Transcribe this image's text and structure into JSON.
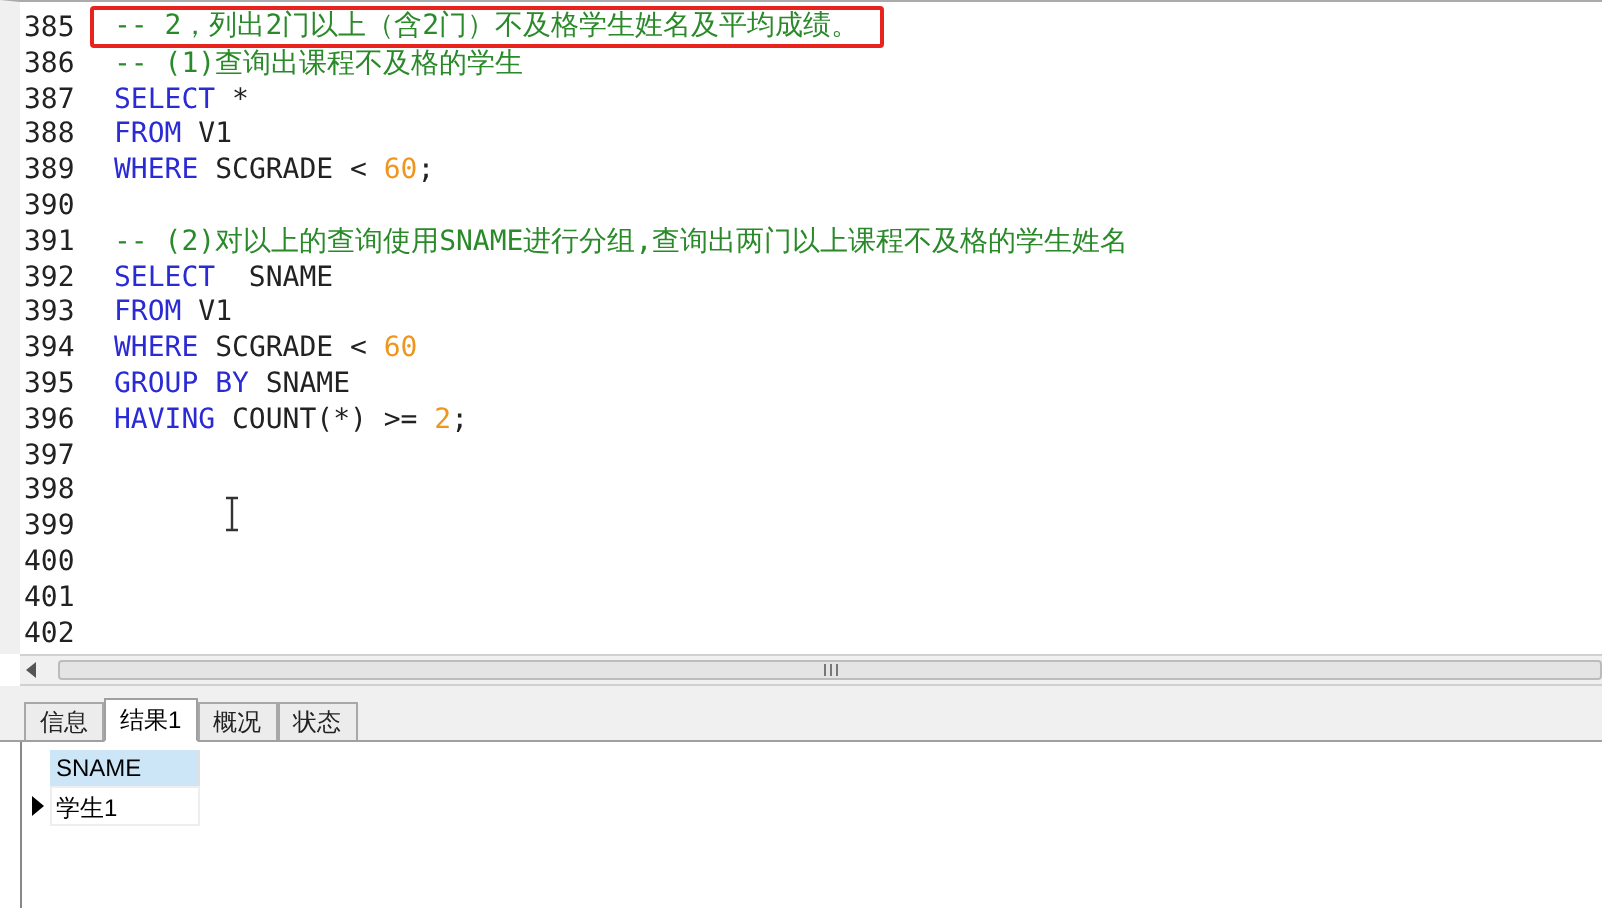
{
  "editor": {
    "lines": [
      {
        "number": "385",
        "highlighted": true,
        "tokens": [
          {
            "kind": "comment",
            "text": "-- 2，列出2门以上（含2门）不及格学生姓名及平均成绩。"
          }
        ]
      },
      {
        "number": "386",
        "highlighted": false,
        "tokens": [
          {
            "kind": "comment",
            "text": "-- (1)查询出课程不及格的学生"
          }
        ]
      },
      {
        "number": "387",
        "highlighted": false,
        "tokens": [
          {
            "kind": "keyword",
            "text": "SELECT"
          },
          {
            "kind": "plain",
            "text": " *"
          }
        ]
      },
      {
        "number": "388",
        "highlighted": false,
        "tokens": [
          {
            "kind": "keyword",
            "text": "FROM"
          },
          {
            "kind": "plain",
            "text": " V1"
          }
        ]
      },
      {
        "number": "389",
        "highlighted": false,
        "tokens": [
          {
            "kind": "keyword",
            "text": "WHERE"
          },
          {
            "kind": "plain",
            "text": " SCGRADE < "
          },
          {
            "kind": "number",
            "text": "60"
          },
          {
            "kind": "plain",
            "text": ";"
          }
        ]
      },
      {
        "number": "390",
        "highlighted": false
      },
      {
        "number": "391",
        "highlighted": false,
        "tokens": [
          {
            "kind": "comment",
            "text": "-- (2)对以上的查询使用SNAME进行分组,查询出两门以上课程不及格的学生姓名"
          }
        ]
      },
      {
        "number": "392",
        "highlighted": false,
        "tokens": [
          {
            "kind": "keyword",
            "text": "SELECT"
          },
          {
            "kind": "plain",
            "text": "  SNAME"
          }
        ]
      },
      {
        "number": "393",
        "highlighted": false,
        "tokens": [
          {
            "kind": "keyword",
            "text": "FROM"
          },
          {
            "kind": "plain",
            "text": " V1"
          }
        ]
      },
      {
        "number": "394",
        "highlighted": false,
        "tokens": [
          {
            "kind": "keyword",
            "text": "WHERE"
          },
          {
            "kind": "plain",
            "text": " SCGRADE < "
          },
          {
            "kind": "number",
            "text": "60"
          }
        ]
      },
      {
        "number": "395",
        "highlighted": false,
        "tokens": [
          {
            "kind": "keyword",
            "text": "GROUP BY"
          },
          {
            "kind": "plain",
            "text": " SNAME"
          }
        ]
      },
      {
        "number": "396",
        "highlighted": false,
        "tokens": [
          {
            "kind": "keyword",
            "text": "HAVING"
          },
          {
            "kind": "plain",
            "text": " COUNT(*) >= "
          },
          {
            "kind": "number",
            "text": "2"
          },
          {
            "kind": "plain",
            "text": ";"
          }
        ]
      },
      {
        "number": "397",
        "highlighted": false
      },
      {
        "number": "398",
        "highlighted": false
      },
      {
        "number": "399",
        "highlighted": false
      },
      {
        "number": "400",
        "highlighted": false
      },
      {
        "number": "401",
        "highlighted": false
      },
      {
        "number": "402",
        "highlighted": false
      }
    ]
  },
  "tabs": [
    {
      "label": "信息",
      "selected": false
    },
    {
      "label": "结果1",
      "selected": true
    },
    {
      "label": "概况",
      "selected": false
    },
    {
      "label": "状态",
      "selected": false
    }
  ],
  "result": {
    "columns": [
      "SNAME"
    ],
    "rows": [
      {
        "selected": true,
        "cells": [
          "学生1"
        ]
      }
    ]
  }
}
